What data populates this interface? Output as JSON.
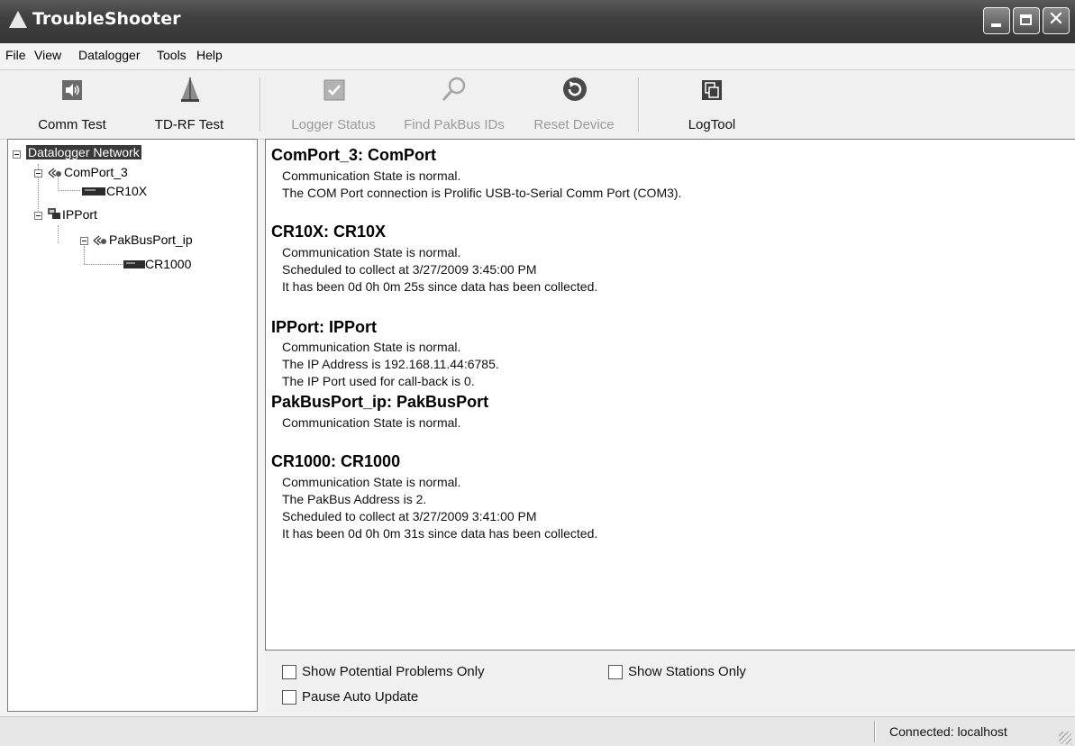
{
  "window": {
    "title": "TroubleShooter"
  },
  "menu": {
    "items": [
      "File",
      "View",
      "Datalogger",
      "Tools",
      "Help"
    ]
  },
  "toolbar": {
    "comm_test": "Comm Test",
    "tdrf_test": "TD-RF Test",
    "logger_status": "Logger Status",
    "find_pakbus": "Find PakBus IDs",
    "reset_device": "Reset Device",
    "logtool": "LogTool"
  },
  "tree": {
    "root": "Datalogger Network",
    "comport": "ComPort_3",
    "cr10x": "CR10X",
    "ipport": "IPPort",
    "pakbusport": "PakBusPort_ip",
    "cr1000": "CR1000"
  },
  "status_sections": [
    {
      "heading": "ComPort_3: ComPort",
      "lines": [
        "Communication State is normal.",
        "The COM Port connection is Prolific USB-to-Serial Comm Port (COM3)."
      ]
    },
    {
      "heading": "CR10X: CR10X",
      "lines": [
        "Communication State is normal.",
        "Scheduled to collect at 3/27/2009 3:45:00 PM",
        "It has been 0d 0h 0m 25s since data has been collected."
      ]
    },
    {
      "heading": "IPPort: IPPort",
      "lines": [
        "Communication State is normal.",
        "The IP Address is 192.168.11.44:6785.",
        "The IP Port used for call-back is 0."
      ]
    },
    {
      "heading": "PakBusPort_ip: PakBusPort",
      "lines": [
        "Communication State is normal."
      ]
    },
    {
      "heading": "CR1000: CR1000",
      "lines": [
        "Communication State is normal.",
        "The PakBus Address is 2.",
        "Scheduled to collect at 3/27/2009 3:41:00 PM",
        "It has been 0d 0h 0m 31s since data has been collected."
      ]
    }
  ],
  "options": {
    "show_problems": {
      "label": "Show Potential Problems Only",
      "checked": false
    },
    "show_stations": {
      "label": "Show Stations Only",
      "checked": false
    },
    "pause_update": {
      "label": "Pause Auto Update",
      "checked": false
    }
  },
  "statusbar": {
    "connection": "Connected: localhost"
  },
  "icons": {
    "app": "warning-triangle-icon",
    "comm_test": "speaker-icon",
    "tdrf_test": "antenna-icon",
    "logger_status": "checkbox-icon",
    "find_pakbus": "magnifier-icon",
    "reset_device": "reset-icon",
    "logtool": "logtool-icon",
    "comport": "serial-port-icon",
    "ipport": "network-icon",
    "datalogger": "datalogger-icon"
  }
}
